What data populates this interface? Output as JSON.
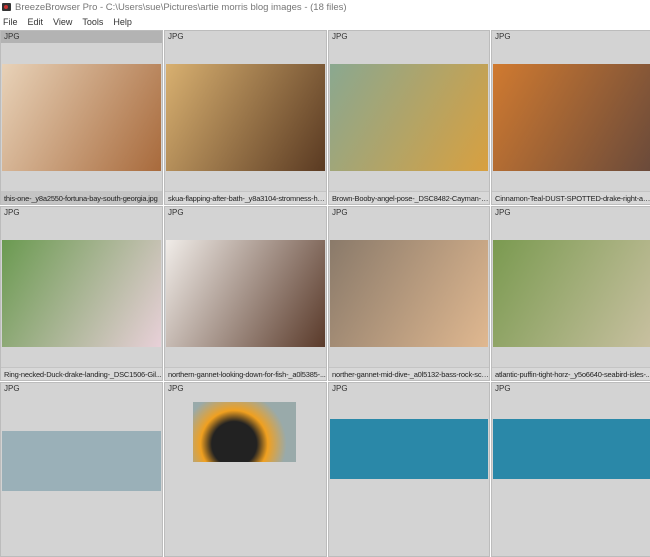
{
  "window": {
    "title": "BreezeBrowser Pro - C:\\Users\\sue\\Pictures\\artie morris blog images - (18 files)"
  },
  "menu": [
    "File",
    "Edit",
    "View",
    "Tools",
    "Help"
  ],
  "thumbnails": [
    {
      "type": "JPG",
      "name": "this-one-_y8a2550-fortuna-bay-south-georgia.jpg",
      "colors": [
        "#e8d2b8",
        "#a86a3c"
      ],
      "selected": true
    },
    {
      "type": "JPG",
      "name": "skua-flapping-after-bath-_y8a3104-stromness-ha...",
      "colors": [
        "#d8b070",
        "#5a3a22"
      ]
    },
    {
      "type": "JPG",
      "name": "Brown-Booby-angel-pose-_DSC8482-Cayman-Br...",
      "colors": [
        "#8aa890",
        "#d8a040"
      ]
    },
    {
      "type": "JPG",
      "name": "Cinnamon-Teal-DUST-SPOTTED-drake-right-at-...",
      "colors": [
        "#d07a30",
        "#6a4a3a"
      ]
    },
    {
      "type": "JPG",
      "name": "Ring-necked-Duck-drake-landing-_DSC1506-Gil...",
      "colors": [
        "#6a9a50",
        "#e8d0d8"
      ]
    },
    {
      "type": "JPG",
      "name": "northern-gannet-looking-down-for-fish-_a0l5385-...",
      "colors": [
        "#f0ece8",
        "#5a3a2a"
      ]
    },
    {
      "type": "JPG",
      "name": "norther-gannet-mid-dive-_a0l5132-bass-rock-sco...",
      "colors": [
        "#8a7a6a",
        "#e0b890"
      ]
    },
    {
      "type": "JPG",
      "name": "atlantic-puffin-tight-horz-_y5o6640-seabird-isles-...",
      "colors": [
        "#7a9a50",
        "#c8c0a0"
      ]
    },
    {
      "type": "JPG",
      "name": "",
      "colors": [
        "#9ab0b8",
        "#9ab0b8"
      ]
    },
    {
      "type": "JPG",
      "name": "",
      "colors": [
        "#f0a020",
        "#222222"
      ]
    },
    {
      "type": "JPG",
      "name": "",
      "colors": [
        "#2a88a8",
        "#2a88a8"
      ]
    },
    {
      "type": "JPG",
      "name": "",
      "colors": [
        "#2a88a8",
        "#2a88a8"
      ]
    }
  ]
}
